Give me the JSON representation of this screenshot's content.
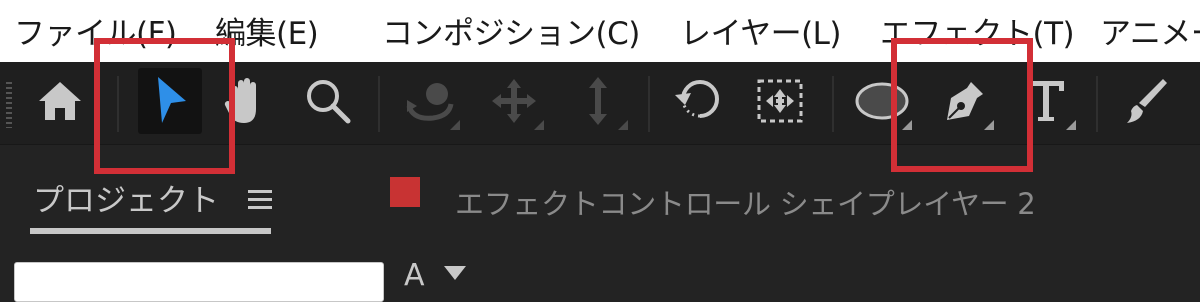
{
  "menubar": {
    "items": [
      {
        "label": "ファイル(F)"
      },
      {
        "label": "編集(E)"
      },
      {
        "label": "コンポジション(C)"
      },
      {
        "label": "レイヤー(L)"
      },
      {
        "label": "エフェクト(T)"
      },
      {
        "label": "アニメーション"
      }
    ]
  },
  "toolbar": {
    "tools": [
      {
        "icon": "home-icon"
      },
      {
        "icon": "selection-arrow-icon",
        "active": true
      },
      {
        "icon": "hand-icon"
      },
      {
        "icon": "zoom-icon"
      },
      {
        "icon": "orbit-camera-icon",
        "enabled": false
      },
      {
        "icon": "pan-move-icon",
        "enabled": false
      },
      {
        "icon": "dolly-icon",
        "enabled": false
      },
      {
        "icon": "rotate-icon"
      },
      {
        "icon": "anchor-point-icon"
      },
      {
        "icon": "ellipse-icon"
      },
      {
        "icon": "pen-icon"
      },
      {
        "icon": "type-icon"
      },
      {
        "icon": "brush-icon"
      }
    ],
    "highlight_color": "#d22f36",
    "active_color": "#2e8fe8"
  },
  "panel": {
    "project_tab": "プロジェクト",
    "menu_icon": "hamburger-icon",
    "effect_controls_tab": "エフェクトコントロール シェイプレイヤー 2",
    "layer_color": "#c83333"
  },
  "search": {
    "value": "",
    "font_label": "A"
  }
}
